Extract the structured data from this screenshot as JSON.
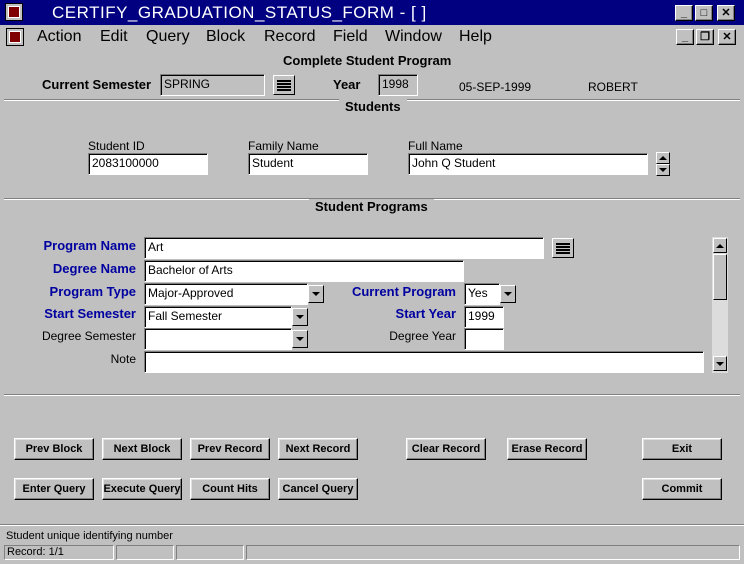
{
  "window": {
    "title": "CERTIFY_GRADUATION_STATUS_FORM - [ ]"
  },
  "menu": [
    "Action",
    "Edit",
    "Query",
    "Block",
    "Record",
    "Field",
    "Window",
    "Help"
  ],
  "form_title": "Complete Student Program",
  "header": {
    "semester_label": "Current Semester",
    "semester_value": "SPRING",
    "year_label": "Year",
    "year_value": "1998",
    "date": "05-SEP-1999",
    "user": "ROBERT"
  },
  "students": {
    "title": "Students",
    "id_label": "Student ID",
    "id_value": "2083100000",
    "family_label": "Family Name",
    "family_value": "Student",
    "full_label": "Full Name",
    "full_value": "John Q Student"
  },
  "programs": {
    "title": "Student Programs",
    "program_name_label": "Program Name",
    "program_name_value": "Art",
    "degree_name_label": "Degree Name",
    "degree_name_value": "Bachelor of Arts",
    "program_type_label": "Program Type",
    "program_type_value": "Major-Approved",
    "current_program_label": "Current Program",
    "current_program_value": "Yes",
    "start_semester_label": "Start Semester",
    "start_semester_value": "Fall Semester",
    "start_year_label": "Start Year",
    "start_year_value": "1999",
    "degree_semester_label": "Degree Semester",
    "degree_semester_value": "",
    "degree_year_label": "Degree Year",
    "degree_year_value": "",
    "note_label": "Note",
    "note_value": ""
  },
  "buttons": {
    "prev_block": "Prev Block",
    "next_block": "Next Block",
    "prev_record": "Prev Record",
    "next_record": "Next Record",
    "clear_record": "Clear Record",
    "erase_record": "Erase Record",
    "exit": "Exit",
    "enter_query": "Enter Query",
    "execute_query": "Execute Query",
    "count_hits": "Count Hits",
    "cancel_query": "Cancel Query",
    "commit": "Commit"
  },
  "statusbar": {
    "hint": "Student unique identifying number",
    "record": "Record: 1/1"
  },
  "icons": {
    "app": "oracle-forms-icon",
    "minimize": "minimize-icon",
    "maximize": "maximize-icon",
    "restore": "restore-icon",
    "close": "close-icon",
    "lov": "list-of-values-icon",
    "dropdown": "dropdown-arrow-icon"
  },
  "colors": {
    "titlebar": "#000080",
    "required_label": "#0000a0",
    "background": "#c0c0c0"
  }
}
